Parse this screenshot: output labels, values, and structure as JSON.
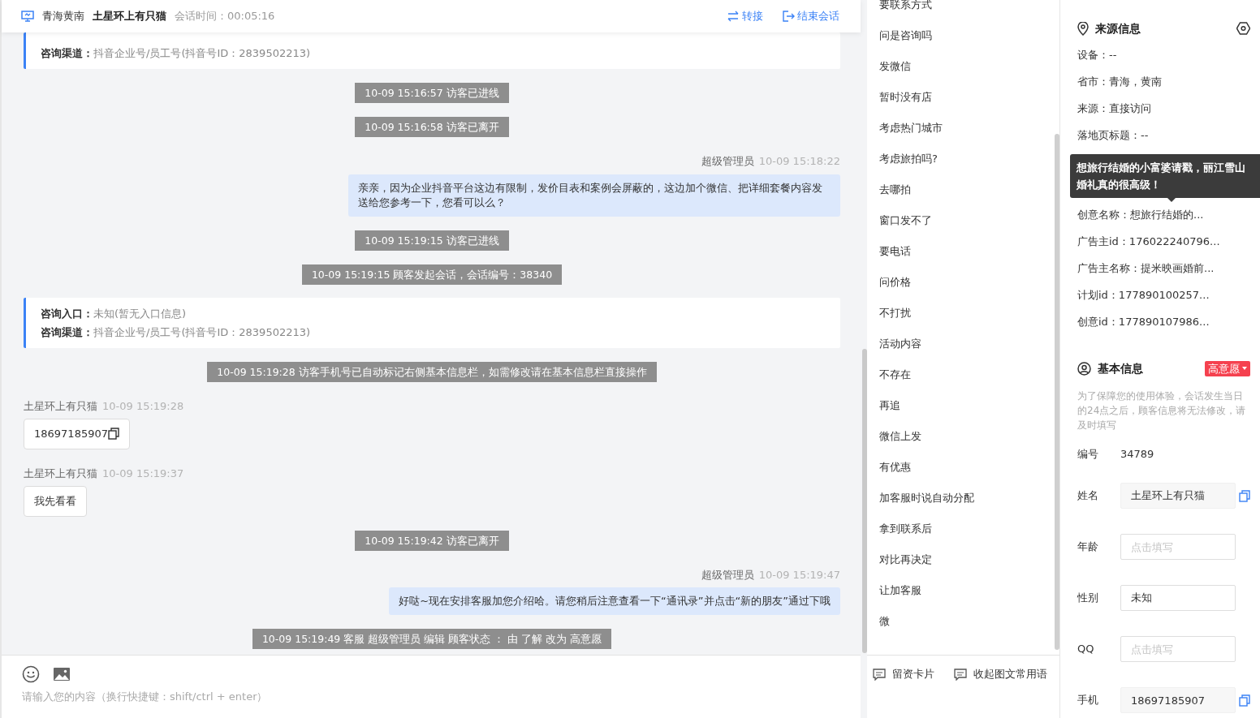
{
  "header": {
    "location": "青海黄南",
    "visitor": "土星环上有只猫",
    "duration": "会话时间：00:05:16",
    "actions": [
      {
        "kind": "transfer",
        "label": "转接"
      },
      {
        "kind": "end",
        "label": "结束会话"
      }
    ]
  },
  "messages": [
    {
      "kind": "info",
      "lines": [
        {
          "label": "咨询渠道：",
          "value": "抖音企业号/员工号(抖音号ID：2839502213)"
        }
      ]
    },
    {
      "kind": "system",
      "text": "10-09 15:16:57 访客已进线"
    },
    {
      "kind": "system",
      "text": "10-09 15:16:58 访客已离开"
    },
    {
      "kind": "agent",
      "sender": "超级管理员",
      "time": "10-09 15:18:22",
      "text": "亲亲，因为企业抖音平台这边有限制，发价目表和案例会屏蔽的，这边加个微信、把详细套餐内容发送给您参考一下，您看可以么？"
    },
    {
      "kind": "system",
      "text": "10-09 15:19:15 访客已进线"
    },
    {
      "kind": "system",
      "text": "10-09 15:19:15 顾客发起会话，会话编号：38340"
    },
    {
      "kind": "info",
      "lines": [
        {
          "label": "咨询入口：",
          "value": "未知(暂无入口信息)"
        },
        {
          "label": "咨询渠道：",
          "value": "抖音企业号/员工号(抖音号ID：2839502213)"
        }
      ]
    },
    {
      "kind": "system",
      "text": "10-09 15:19:28 访客手机号已自动标记右侧基本信息栏，如需修改请在基本信息栏直接操作"
    },
    {
      "kind": "visitor",
      "sender": "土星环上有只猫",
      "time": "10-09 15:19:28",
      "text": "18697185907",
      "copyable": true
    },
    {
      "kind": "visitor",
      "sender": "土星环上有只猫",
      "time": "10-09 15:19:37",
      "text": "我先看看",
      "copyable": false
    },
    {
      "kind": "system",
      "text": "10-09 15:19:42 访客已离开"
    },
    {
      "kind": "agent",
      "sender": "超级管理员",
      "time": "10-09 15:19:47",
      "text": "好哒~现在安排客服加您介绍哈。请您稍后注意查看一下“通讯录”并点击“新的朋友”通过下哦"
    },
    {
      "kind": "system",
      "text": "10-09 15:19:49 客服 超级管理员 编辑 顾客状态 ： 由 了解 改为 高意愿"
    }
  ],
  "composer": {
    "tools": [
      {
        "kind": "emoji"
      },
      {
        "kind": "image"
      }
    ],
    "placeholder": "请输入您的内容（换行快捷键：shift/ctrl + enter）"
  },
  "phrases": [
    "要联系方式",
    "问是咨询吗",
    "发微信",
    "暂时没有店",
    "考虑热门城市",
    "考虑旅拍吗?",
    "去哪拍",
    "窗口发不了",
    "要电话",
    "问价格",
    "不打扰",
    "活动内容",
    "不存在",
    "再追",
    "微信上发",
    "有优惠",
    "加客服时说自动分配",
    "拿到联系后",
    "对比再决定",
    "让加客服",
    "微"
  ],
  "phrase_actions": [
    {
      "label": "留资卡片"
    },
    {
      "label": "收起图文常用语"
    }
  ],
  "source_info": {
    "title": "来源信息",
    "items_before": [
      "设备：--",
      "省市：青海，黄南",
      "来源：直接访问",
      "落地页标题：--"
    ],
    "tooltip": [
      "想旅行结婚的小富婆请戳，丽江雪山",
      "婚礼真的很高级！"
    ],
    "items_after": [
      "创意名称：想旅行结婚的...",
      "广告主id：176022240796...",
      "广告主名称：提米映画婚前...",
      "计划id：177890100257...",
      "创意id：177890107986..."
    ]
  },
  "basic_info": {
    "title": "基本信息",
    "intent": {
      "label": "高意愿",
      "color": "#f5414f"
    },
    "note": "为了保障您的使用体验，会话发生当日的24点之后，顾客信息将无法修改，请及时填写",
    "number": {
      "label": "编号",
      "value": "34789"
    },
    "fields": [
      {
        "label": "姓名",
        "value": "土星环上有只猫",
        "readonly": true,
        "copyable": true
      },
      {
        "label": "年龄",
        "placeholder": "点击填写",
        "readonly": false,
        "copyable": false
      },
      {
        "label": "性别",
        "value": "未知",
        "readonly": false,
        "copyable": false
      },
      {
        "label": "QQ",
        "placeholder": "点击填写",
        "readonly": false,
        "copyable": false
      },
      {
        "label": "手机",
        "value": "18697185907",
        "readonly": true,
        "copyable": true
      }
    ]
  }
}
